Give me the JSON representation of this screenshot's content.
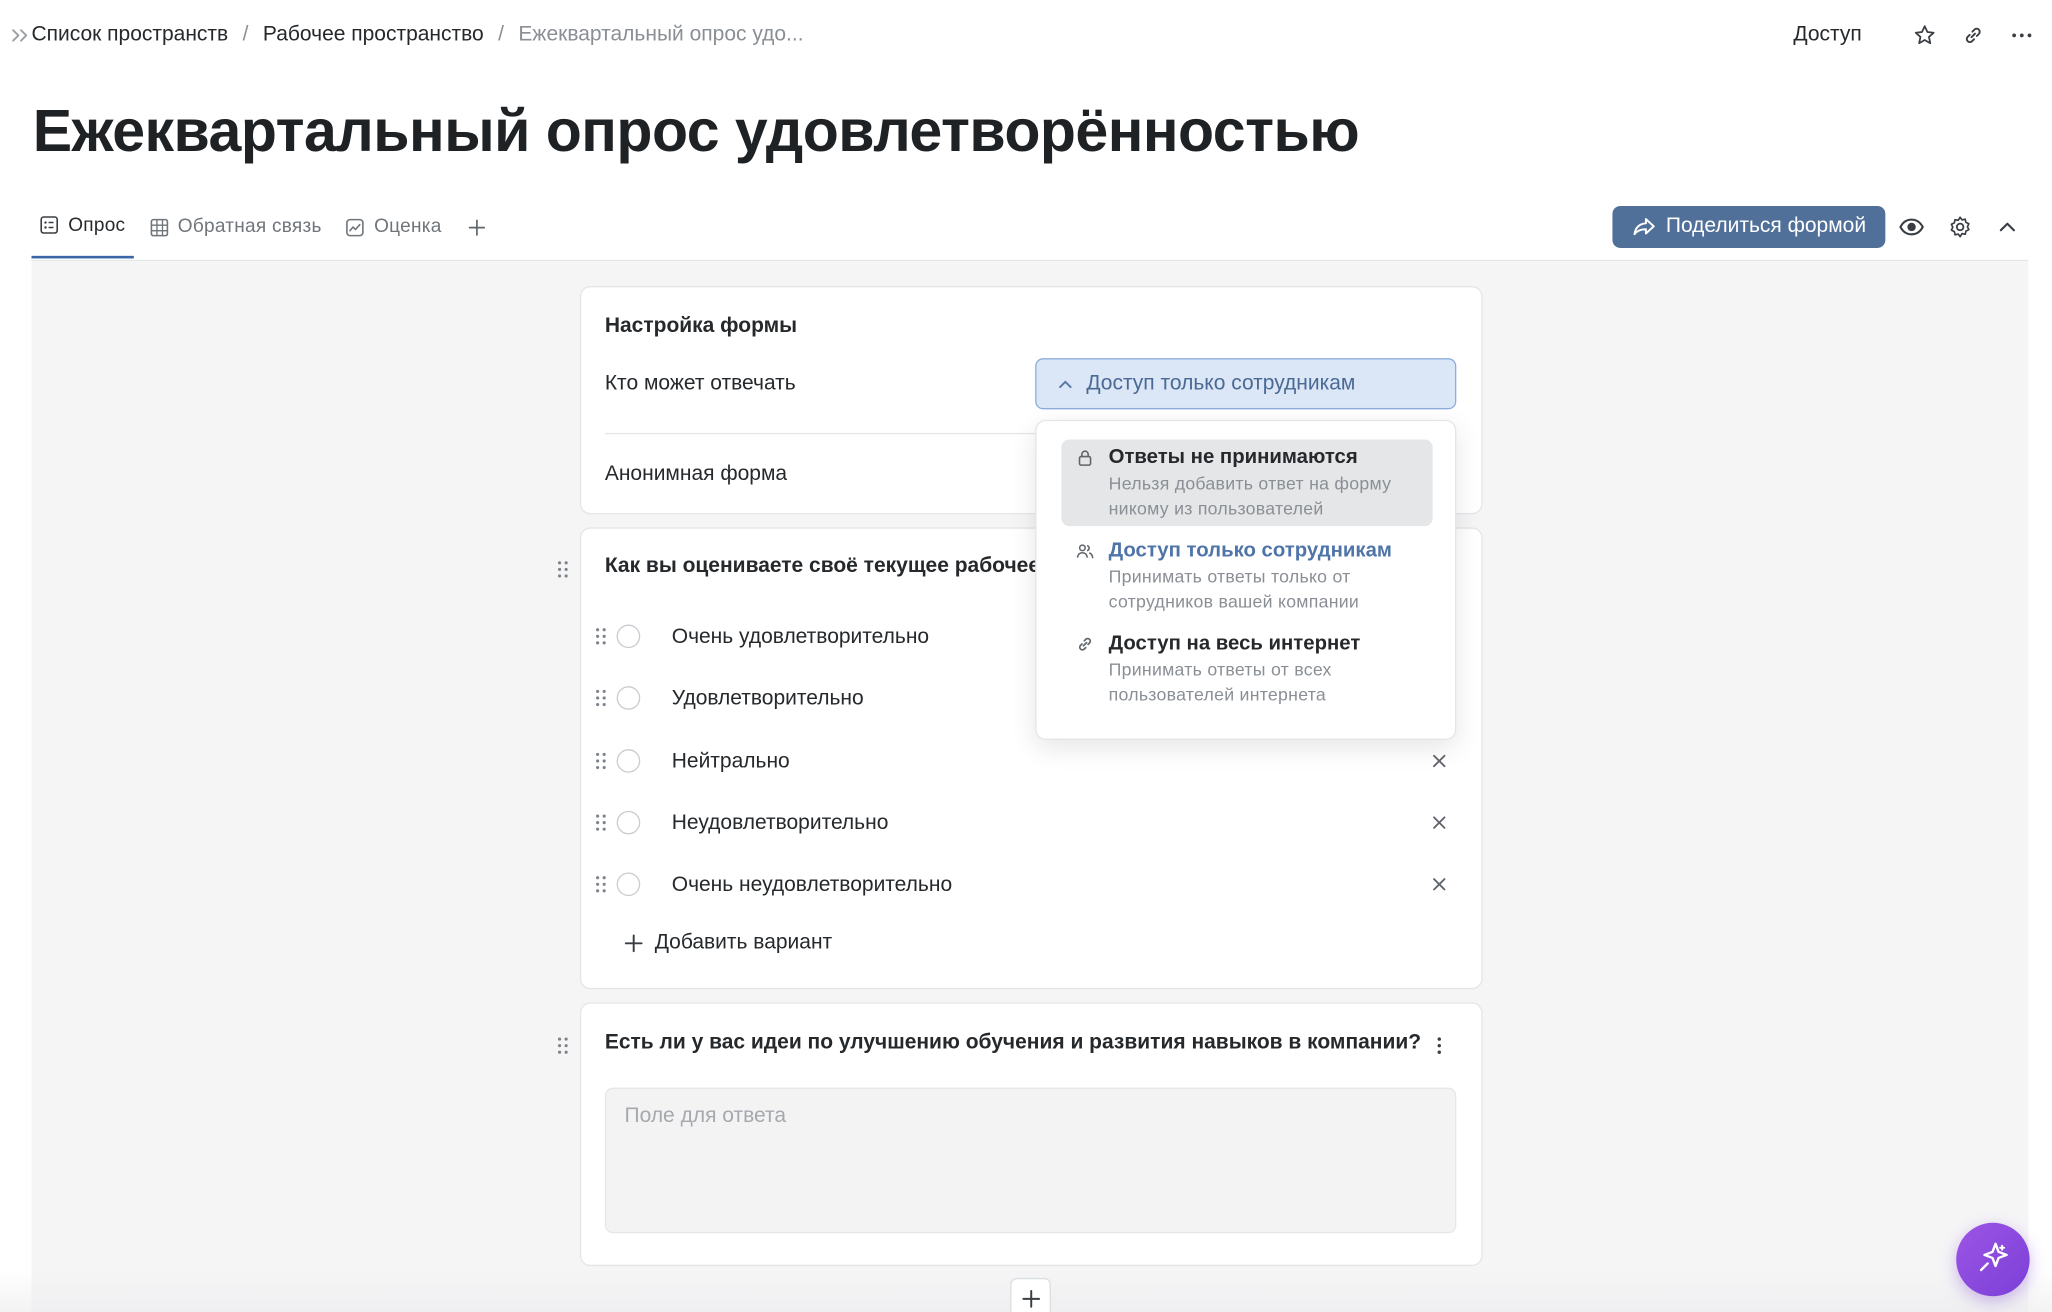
{
  "breadcrumb": {
    "items": [
      "Список пространств",
      "Рабочее пространство",
      "Ежеквартальный опрос удо..."
    ],
    "separator": "/"
  },
  "header": {
    "access_label": "Доступ",
    "icons": [
      "star-icon",
      "link-icon",
      "more-icon"
    ]
  },
  "page": {
    "title": "Ежеквартальный опрос удовлетворённостью"
  },
  "tabs": [
    {
      "label": "Опрос",
      "icon": "survey-icon",
      "active": true
    },
    {
      "label": "Обратная связь",
      "icon": "table-icon",
      "active": false
    },
    {
      "label": "Оценка",
      "icon": "chart-icon",
      "active": false
    }
  ],
  "toolbar": {
    "share_label": "Поделиться формой",
    "icons": [
      "eye-icon",
      "gear-icon",
      "chevron-up-icon"
    ]
  },
  "form_settings": {
    "title": "Настройка формы",
    "who_can_answer_label": "Кто может отвечать",
    "who_can_answer_value": "Доступ только сотрудникам",
    "anonymous_label": "Анонимная форма"
  },
  "access_dropdown": {
    "options": [
      {
        "title": "Ответы не принимаются",
        "desc_line1": "Нельзя добавить ответ на форму",
        "desc_line2": "никому из пользователей",
        "icon": "lock-icon",
        "hovered": true
      },
      {
        "title": "Доступ только сотрудникам",
        "desc_line1": "Принимать ответы только от",
        "desc_line2": "сотрудников вашей компании",
        "icon": "users-icon",
        "selected": true
      },
      {
        "title": "Доступ на весь интернет",
        "desc_line1": "Принимать ответы от всех",
        "desc_line2": "пользователей интернета",
        "icon": "link-icon"
      }
    ]
  },
  "question1": {
    "title": "Как вы оцениваете своё текущее рабочее",
    "options": [
      "Очень удовлетворительно",
      "Удовлетворительно",
      "Нейтрально",
      "Неудовлетворительно",
      "Очень неудовлетворительно"
    ],
    "add_option_label": "Добавить вариант"
  },
  "question2": {
    "title": "Есть ли у вас идеи по улучшению обучения и развития навыков в компании?",
    "placeholder": "Поле для ответа"
  },
  "colors": {
    "accent": "#50709a",
    "select_bg": "#dbe6f6",
    "selected_text": "#4f74a8",
    "ai_button": "#8a48de"
  }
}
